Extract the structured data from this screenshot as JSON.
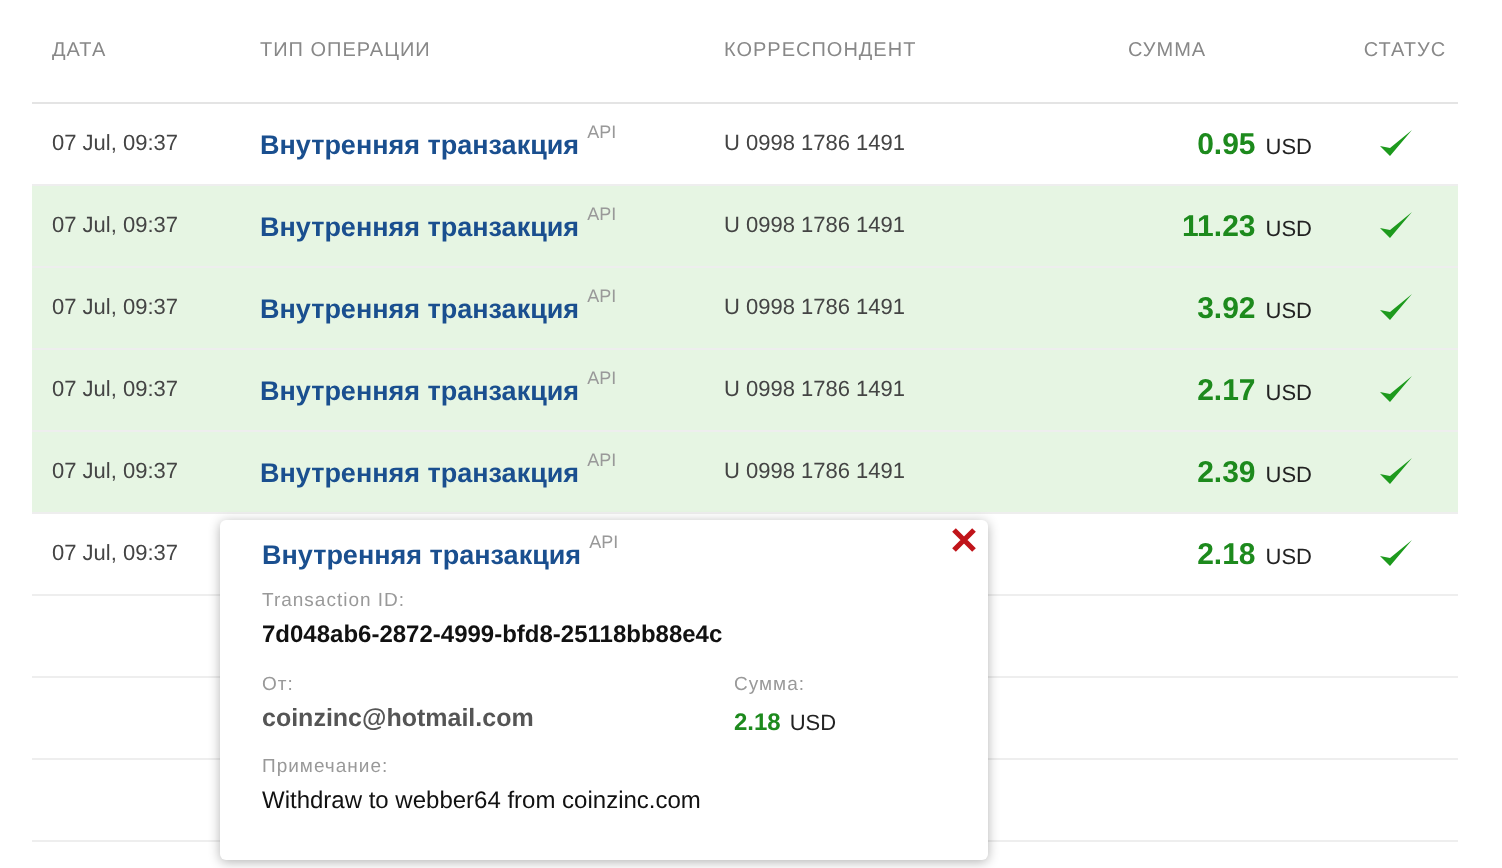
{
  "table": {
    "columns": [
      "ДАТА",
      "ТИП ОПЕРАЦИИ",
      "КОРРЕСПОНДЕНТ",
      "СУММА",
      "СТАТУС"
    ],
    "rows": [
      {
        "date": "07 Jul, 09:37",
        "type": "Внутренняя транзакция",
        "tag": "API",
        "correspondent": "U 0998 1786 1491",
        "amount": "0.95",
        "currency": "USD",
        "highlighted": false,
        "completed": true
      },
      {
        "date": "07 Jul, 09:37",
        "type": "Внутренняя транзакция",
        "tag": "API",
        "correspondent": "U 0998 1786 1491",
        "amount": "11.23",
        "currency": "USD",
        "highlighted": true,
        "completed": true
      },
      {
        "date": "07 Jul, 09:37",
        "type": "Внутренняя транзакция",
        "tag": "API",
        "correspondent": "U 0998 1786 1491",
        "amount": "3.92",
        "currency": "USD",
        "highlighted": true,
        "completed": true
      },
      {
        "date": "07 Jul, 09:37",
        "type": "Внутренняя транзакция",
        "tag": "API",
        "correspondent": "U 0998 1786 1491",
        "amount": "2.17",
        "currency": "USD",
        "highlighted": true,
        "completed": true
      },
      {
        "date": "07 Jul, 09:37",
        "type": "Внутренняя транзакция",
        "tag": "API",
        "correspondent": "U 0998 1786 1491",
        "amount": "2.39",
        "currency": "USD",
        "highlighted": true,
        "completed": true
      },
      {
        "date": "07 Jul, 09:37",
        "amount": "2.18",
        "currency": "USD",
        "highlighted": false,
        "completed": true
      }
    ]
  },
  "popup": {
    "title": "Внутренняя транзакция",
    "tag": "API",
    "id_label": "Transaction ID:",
    "id": "7d048ab6-2872-4999-bfd8-25118bb88e4c",
    "from_label": "От:",
    "from": "coinzinc@hotmail.com",
    "amount_label": "Сумма:",
    "amount": "2.18",
    "currency": "USD",
    "note_label": "Примечание:",
    "note": "Withdraw to webber64 from coinzinc.com"
  }
}
